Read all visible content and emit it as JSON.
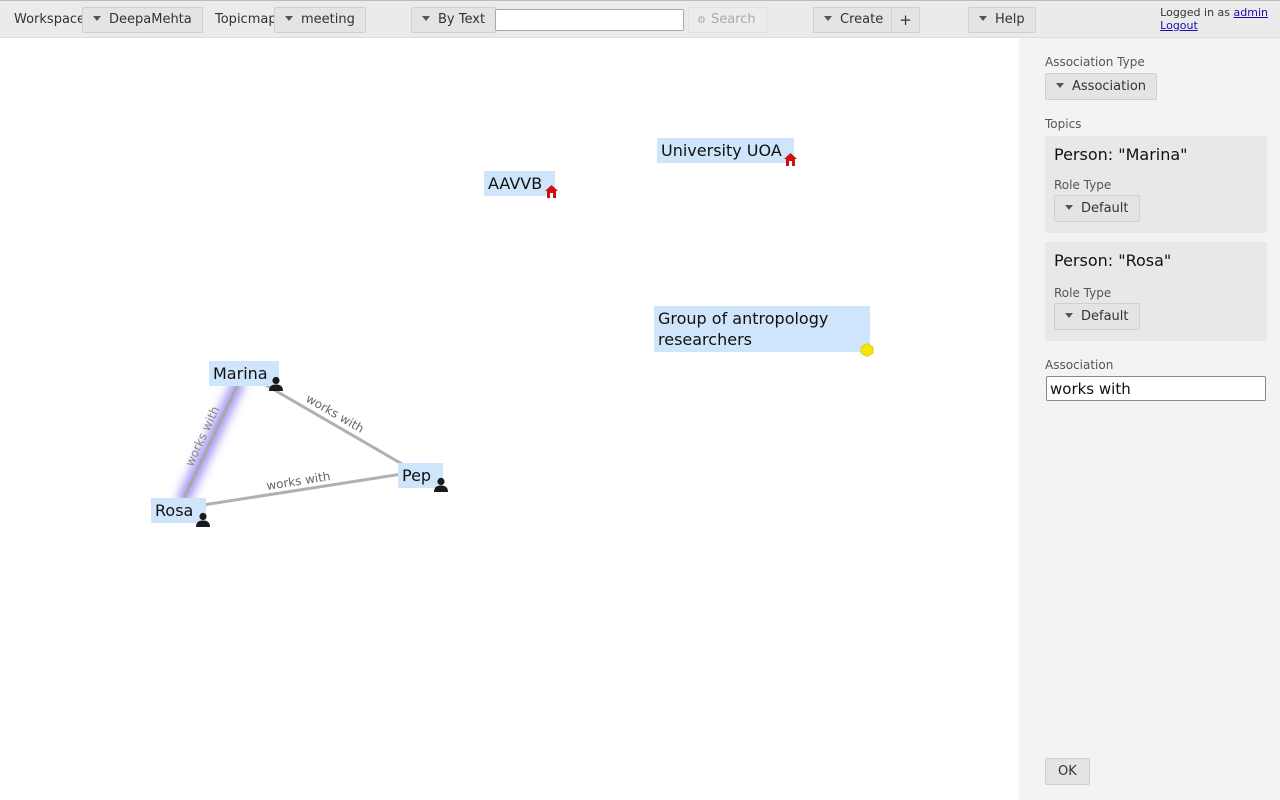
{
  "toolbar": {
    "workspace_label": "Workspace",
    "workspace_value": "DeepaMehta",
    "topicmap_label": "Topicmap",
    "topicmap_value": "meeting",
    "search_mode": "By Text",
    "search_value": "",
    "search_button": "Search",
    "create_label": "Create",
    "plus_label": "+",
    "help_label": "Help",
    "logged_in_text": "Logged in as",
    "user": "admin",
    "logout": "Logout"
  },
  "canvas": {
    "topics": {
      "aavvb": "AAVVB",
      "university": "University UOA",
      "group_line1": "Group of antropology",
      "group_line2": "researchers",
      "marina": "Marina",
      "pep": "Pep",
      "rosa": "Rosa"
    },
    "associations": {
      "marina_pep": "works with",
      "rosa_pep": "works with",
      "marina_rosa": "works with"
    },
    "icons": {
      "institution": "house-icon",
      "person": "person-icon",
      "group": "hexagon-icon"
    },
    "colors": {
      "topic_bg": "#cfe5fb",
      "assoc_line": "#b0b0b0",
      "house": "#cc1111",
      "group": "#f5e600"
    }
  },
  "sidebar": {
    "assoc_type_label": "Association Type",
    "assoc_type_value": "Association",
    "topics_label": "Topics",
    "topic1_title": "Person: \"Marina\"",
    "topic1_role_label": "Role Type",
    "topic1_role_value": "Default",
    "topic2_title": "Person: \"Rosa\"",
    "topic2_role_label": "Role Type",
    "topic2_role_value": "Default",
    "association_label": "Association",
    "association_value": "works with",
    "ok_label": "OK"
  }
}
